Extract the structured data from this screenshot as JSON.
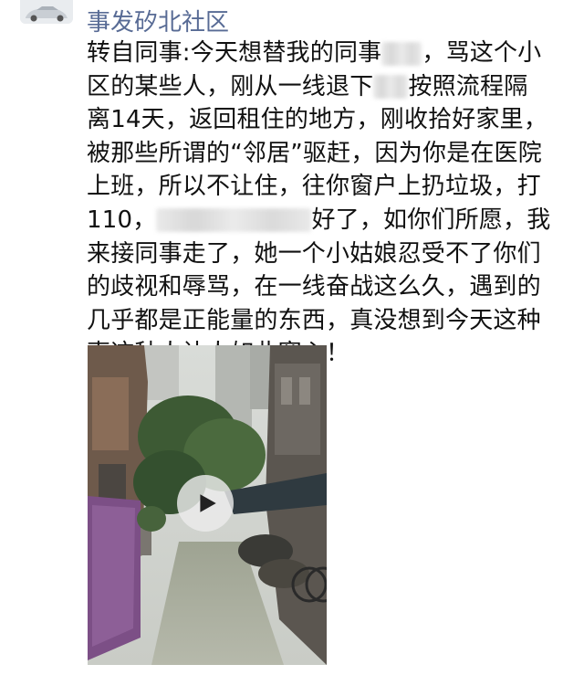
{
  "user": {
    "name": "事发矽北社区",
    "avatar_icon": "car-avatar-icon"
  },
  "post": {
    "lines": [
      [
        "转自同事:今天想替我的同事",
        "，骂这个小"
      ],
      [
        "区的某些人，刚从一线退下",
        "按照流程隔"
      ],
      [
        "离14天，返回租住的地方，刚收拾好家里，"
      ],
      [
        "被那些所谓的“邻居”驱赶，因为你是在医院"
      ],
      [
        "上班，所以不让住，往你窗户上扔垃圾，打"
      ],
      [
        "110，",
        "好了，如你们所愿，我"
      ],
      [
        "来接同事走了，她一个小姑娘忍受不了你们"
      ],
      [
        "的歧视和辱骂，在一线奋战这么久，遇到的"
      ],
      [
        "几乎都是正能量的东西，真没想到今天这种"
      ],
      [
        "事这种人让人如此寒心！"
      ]
    ]
  },
  "video": {
    "play_icon": "play-icon",
    "description_icon": "video-thumbnail-alley"
  },
  "colors": {
    "username": "#586b95",
    "text": "#111111",
    "background": "#ffffff"
  }
}
